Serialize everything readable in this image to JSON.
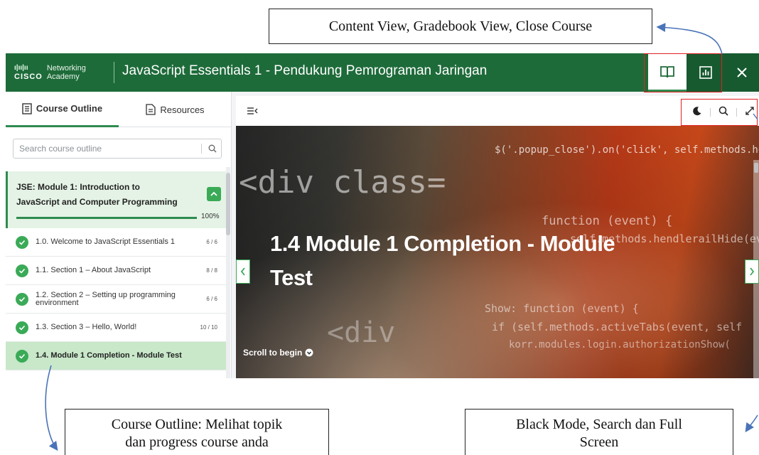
{
  "annotations": {
    "top": "Content View, Gradebook View, Close Course",
    "left_line1": "Course Outline: Melihat topik",
    "left_line2": "dan progress course anda",
    "right_line1": "Black Mode, Search dan Full",
    "right_line2": "Screen"
  },
  "header": {
    "logo_brand": "CISCO",
    "logo_line1": "Networking",
    "logo_line2": "Academy",
    "title": "JavaScript Essentials 1 - Pendukung Pemrograman Jaringan"
  },
  "sidebar": {
    "tabs": [
      {
        "label": "Course Outline",
        "icon": "outline-icon"
      },
      {
        "label": "Resources",
        "icon": "document-icon"
      }
    ],
    "search": {
      "placeholder": "Search course outline"
    },
    "module": {
      "title": "JSE: Module 1: Introduction to JavaScript and Computer Programming",
      "progress": 100,
      "progress_label": "100%"
    },
    "items": [
      {
        "label": "1.0. Welcome to JavaScript Essentials 1",
        "count": "6 / 6"
      },
      {
        "label": "1.1. Section 1 – About JavaScript",
        "count": "8 / 8"
      },
      {
        "label": "1.2. Section 2 – Setting up programming environment",
        "count": "6 / 6"
      },
      {
        "label": "1.3. Section 3 – Hello, World!",
        "count": "10 / 10"
      },
      {
        "label": "1.4. Module 1 Completion - Module Test",
        "count": ""
      }
    ]
  },
  "main": {
    "hero_title": "1.4 Module 1 Completion - Module Test",
    "scroll_hint": "Scroll to begin",
    "code_lines": [
      "<div class=",
      "$('.popup_close').on('click', self.methods.hen",
      "function (event) {",
      "self.methods.hendlerailHide(event);",
      "Show: function (event) {",
      "if (self.methods.activeTabs(event, self",
      "korr.modules.login.authorizationShow(",
      "<div"
    ]
  },
  "colors": {
    "brand_green": "#1e6b3a",
    "accent_green": "#3aaa57",
    "highlight_red": "#e02020"
  }
}
